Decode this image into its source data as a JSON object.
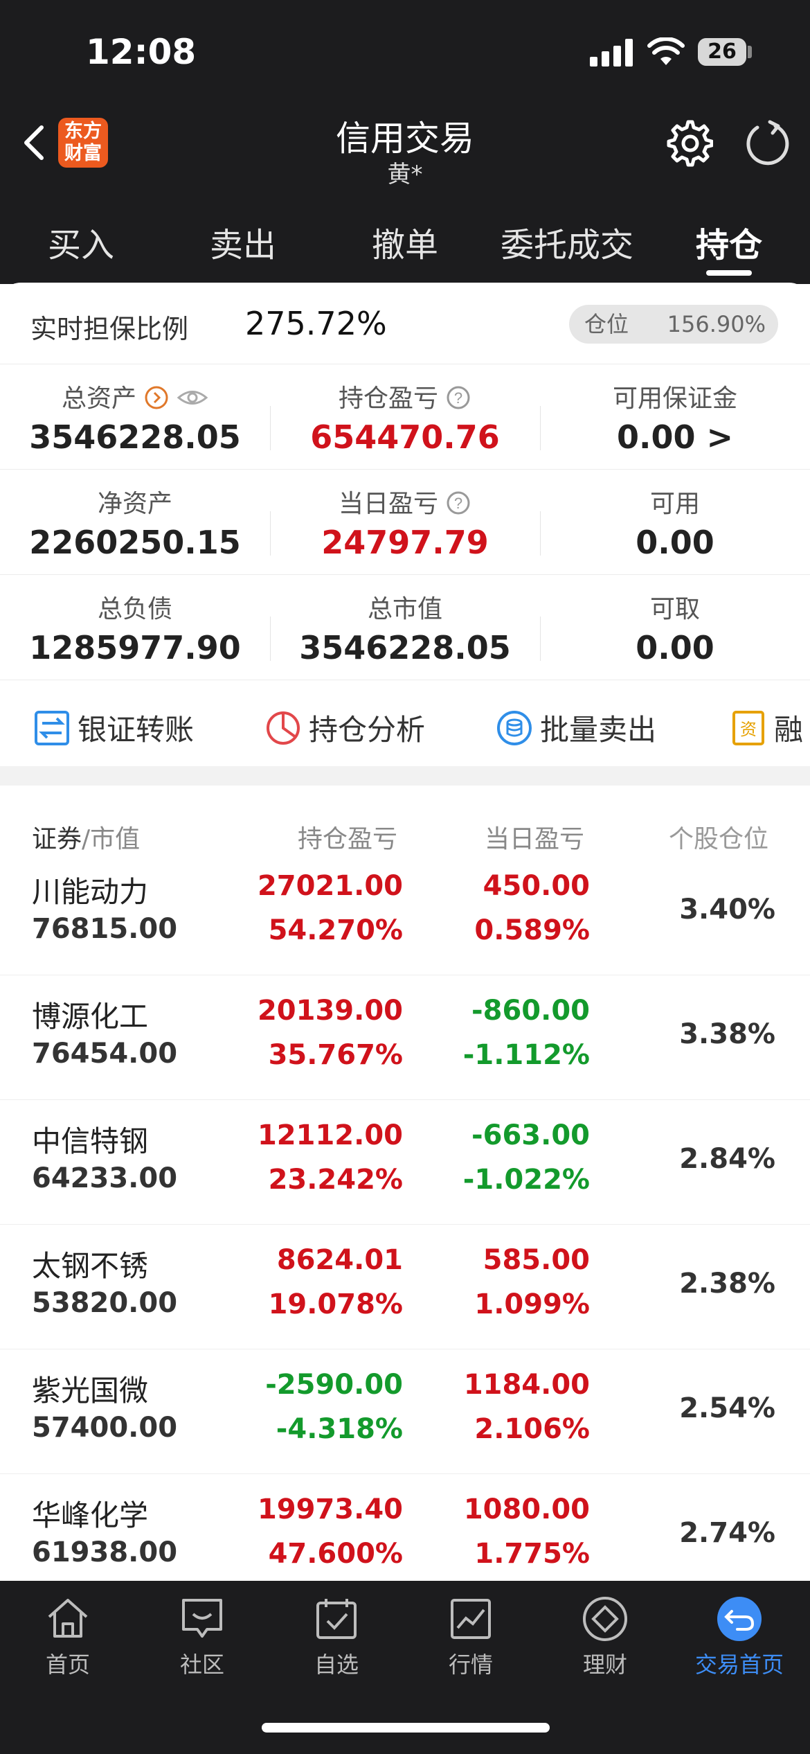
{
  "status_bar": {
    "time": "12:08",
    "battery": "26"
  },
  "header": {
    "logo_line1": "东方",
    "logo_line2": "财富",
    "title": "信用交易",
    "subtitle": "黄*"
  },
  "tabs": [
    {
      "label": "买入"
    },
    {
      "label": "卖出"
    },
    {
      "label": "撤单"
    },
    {
      "label": "委托成交"
    },
    {
      "label": "持仓",
      "active": true
    }
  ],
  "guarantee": {
    "label": "实时担保比例",
    "value": "275.72%",
    "position_label": "仓位",
    "position_value": "156.90%"
  },
  "summary": {
    "total_assets_label": "总资产",
    "total_assets": "3546228.05",
    "holding_pl_label": "持仓盈亏",
    "holding_pl": "654470.76",
    "available_margin_label": "可用保证金",
    "available_margin": "0.00 >",
    "net_assets_label": "净资产",
    "net_assets": "2260250.15",
    "daily_pl_label": "当日盈亏",
    "daily_pl": "24797.79",
    "available_label": "可用",
    "available": "0.00",
    "total_liability_label": "总负债",
    "total_liability": "1285977.90",
    "total_market_value_label": "总市值",
    "total_market_value": "3546228.05",
    "withdrawable_label": "可取",
    "withdrawable": "0.00"
  },
  "quick_actions": [
    {
      "label": "银证转账"
    },
    {
      "label": "持仓分析"
    },
    {
      "label": "批量卖出"
    },
    {
      "label": "融"
    }
  ],
  "table_header": {
    "security": "证券",
    "market_value": "/市值",
    "holding_pl": "持仓盈亏",
    "daily_pl": "当日盈亏",
    "stock_position": "个股仓位"
  },
  "holdings": [
    {
      "name": "川能动力",
      "market_value": "76815.00",
      "pl": "27021.00",
      "pl_pct": "54.270%",
      "day": "450.00",
      "day_pct": "0.589%",
      "position": "3.40%"
    },
    {
      "name": "博源化工",
      "market_value": "76454.00",
      "pl": "20139.00",
      "pl_pct": "35.767%",
      "day": "-860.00",
      "day_pct": "-1.112%",
      "position": "3.38%"
    },
    {
      "name": "中信特钢",
      "market_value": "64233.00",
      "pl": "12112.00",
      "pl_pct": "23.242%",
      "day": "-663.00",
      "day_pct": "-1.022%",
      "position": "2.84%"
    },
    {
      "name": "太钢不锈",
      "market_value": "53820.00",
      "pl": "8624.01",
      "pl_pct": "19.078%",
      "day": "585.00",
      "day_pct": "1.099%",
      "position": "2.38%"
    },
    {
      "name": "紫光国微",
      "market_value": "57400.00",
      "pl": "-2590.00",
      "pl_pct": "-4.318%",
      "day": "1184.00",
      "day_pct": "2.106%",
      "position": "2.54%"
    },
    {
      "name": "华峰化学",
      "market_value": "61938.00",
      "pl": "19973.40",
      "pl_pct": "47.600%",
      "day": "1080.00",
      "day_pct": "1.775%",
      "position": "2.74%"
    }
  ],
  "bottom_nav": [
    {
      "label": "首页",
      "icon": "home-icon"
    },
    {
      "label": "社区",
      "icon": "chat-icon"
    },
    {
      "label": "自选",
      "icon": "calendar-check-icon"
    },
    {
      "label": "行情",
      "icon": "chart-icon"
    },
    {
      "label": "理财",
      "icon": "diamond-icon"
    },
    {
      "label": "交易首页",
      "icon": "trade-back-icon",
      "active": true
    }
  ],
  "colors": {
    "up": "#d0121b",
    "down": "#139a2c",
    "accent": "#3d8df5",
    "logo": "#ec5a1f"
  }
}
